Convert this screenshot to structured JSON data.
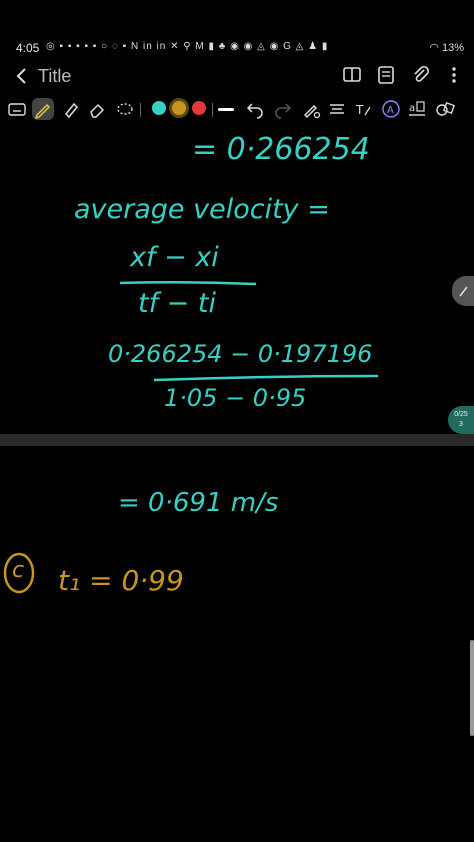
{
  "status": {
    "time": "4:05",
    "icons": "◎ ▪ ▪ ▪ ▪ ▪ ○ ◌ ▪ N in in ✕ ⚲ M ▮ ♣ ◉ ◉ ◬ ◉ G ◬ ♟ ▮",
    "battery": "13%"
  },
  "header": {
    "title": "Title"
  },
  "toolbar": {
    "colors": {
      "teal": "#36d1c4",
      "gold": "#c8961e",
      "red": "#e23a3a"
    }
  },
  "notes": {
    "line1": "= 0·266254",
    "line2": "average velocity =",
    "frac1_num": "xf − xi",
    "frac1_den": "tf − ti",
    "frac2_num": "0·266254 − 0·197196",
    "frac2_den": "1·05 − 0·95",
    "result": "= 0·691 m/s",
    "part_label": "c",
    "part_c": "t₁ = 0·99"
  },
  "page_indicator": {
    "line1": "0/25",
    "line2": "3"
  }
}
